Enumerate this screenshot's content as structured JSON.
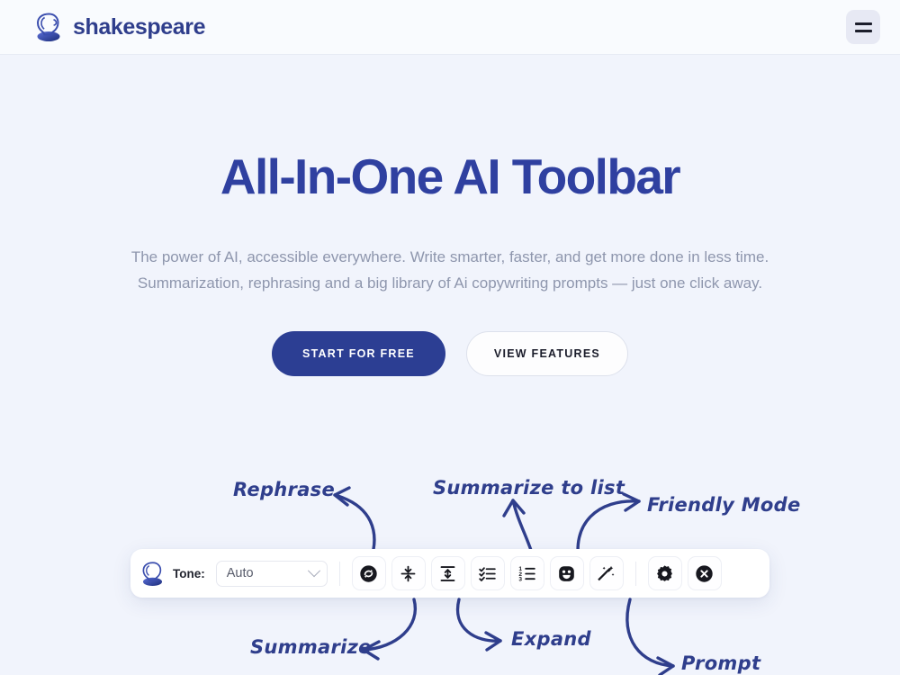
{
  "header": {
    "brand_name": "shakespeare",
    "logo_icon": "shakespeare-head-icon",
    "menu_icon": "hamburger-menu-icon"
  },
  "hero": {
    "title": "All-In-One AI Toolbar",
    "subtitle_line1": "The power of AI, accessible everywhere. Write smarter, faster, and get more done in less time.",
    "subtitle_line2": "Summarization, rephrasing and a big library of Ai copywriting prompts — just one click away.",
    "primary_cta": "START FOR FREE",
    "secondary_cta": "VIEW FEATURES"
  },
  "toolbar": {
    "logo_icon": "shakespeare-head-icon",
    "tone_label": "Tone:",
    "tone_value": "Auto",
    "tone_chevron_icon": "chevron-down-icon",
    "buttons": [
      {
        "name": "rephrase-button",
        "icon": "refresh-circle-icon"
      },
      {
        "name": "summarize-button",
        "icon": "collapse-arrows-icon"
      },
      {
        "name": "expand-button",
        "icon": "expand-arrows-icon"
      },
      {
        "name": "summarize-to-list-button",
        "icon": "checklist-icon"
      },
      {
        "name": "numbered-list-button",
        "icon": "numbered-list-icon"
      },
      {
        "name": "friendly-mode-button",
        "icon": "smiley-face-icon"
      },
      {
        "name": "prompt-button",
        "icon": "magic-wand-icon"
      },
      {
        "name": "settings-button",
        "icon": "gear-icon"
      },
      {
        "name": "close-button",
        "icon": "close-circle-icon"
      }
    ]
  },
  "annotations": {
    "rephrase": "Rephrase",
    "summarize_to_list": "Summarize to list",
    "friendly_mode": "Friendly Mode",
    "summarize": "Summarize",
    "expand": "Expand",
    "prompt": "Prompt"
  },
  "colors": {
    "page_bg": "#F1F4FC",
    "header_bg": "#F9FBFE",
    "brand_blue": "#2F3E8C",
    "title_blue": "#2F40A0",
    "primary_button": "#2C3E93",
    "subtitle_gray": "#8E96AD",
    "annotation_blue": "#2F3E8C"
  }
}
